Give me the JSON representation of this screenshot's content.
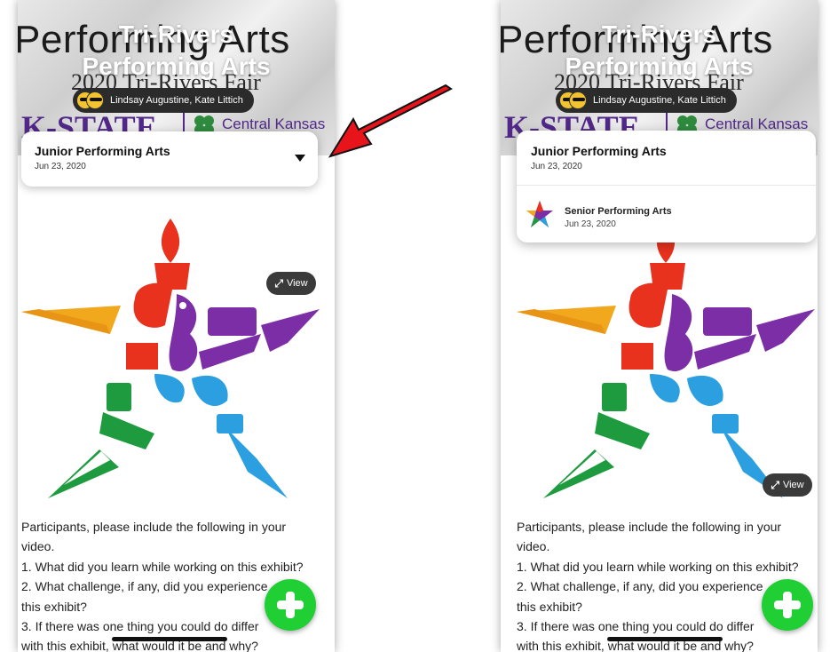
{
  "banner": {
    "bg_title": "Performing Arts",
    "bg_subtitle": "2020 Tri-Rivers Fair",
    "bg_kstate": "K-STATE",
    "bg_central": "Central Kansas",
    "overlay_line1": "Tri-Rivers",
    "overlay_line2": "Performing Arts",
    "judges": "Lindsay Augustine, Kate Littich"
  },
  "dropdown": {
    "selected_title": "Junior Performing Arts",
    "selected_date": "Jun 23, 2020",
    "option_title": "Senior Performing Arts",
    "option_date": "Jun 23, 2020"
  },
  "media": {
    "view_label": "View"
  },
  "description": {
    "line1": "Participants, please include the following in your",
    "line2": "video.",
    "line3": "1. What did you learn while working on this exhibit?",
    "line4": "2. What challenge, if any, did you experience",
    "line5": "this exhibit?",
    "line6": "3. If there was one thing you could do differ",
    "line7": "with this exhibit, what would it be and why?"
  },
  "colors": {
    "fab_green": "#1fcf34",
    "annotation_arrow": "#e8141c",
    "kstate_purple": "#512888"
  },
  "icons": {
    "expand": "expand-arrows-icon",
    "add": "plus-icon",
    "caret_closed": "caret-down-icon",
    "caret_open": "caret-up-icon"
  }
}
